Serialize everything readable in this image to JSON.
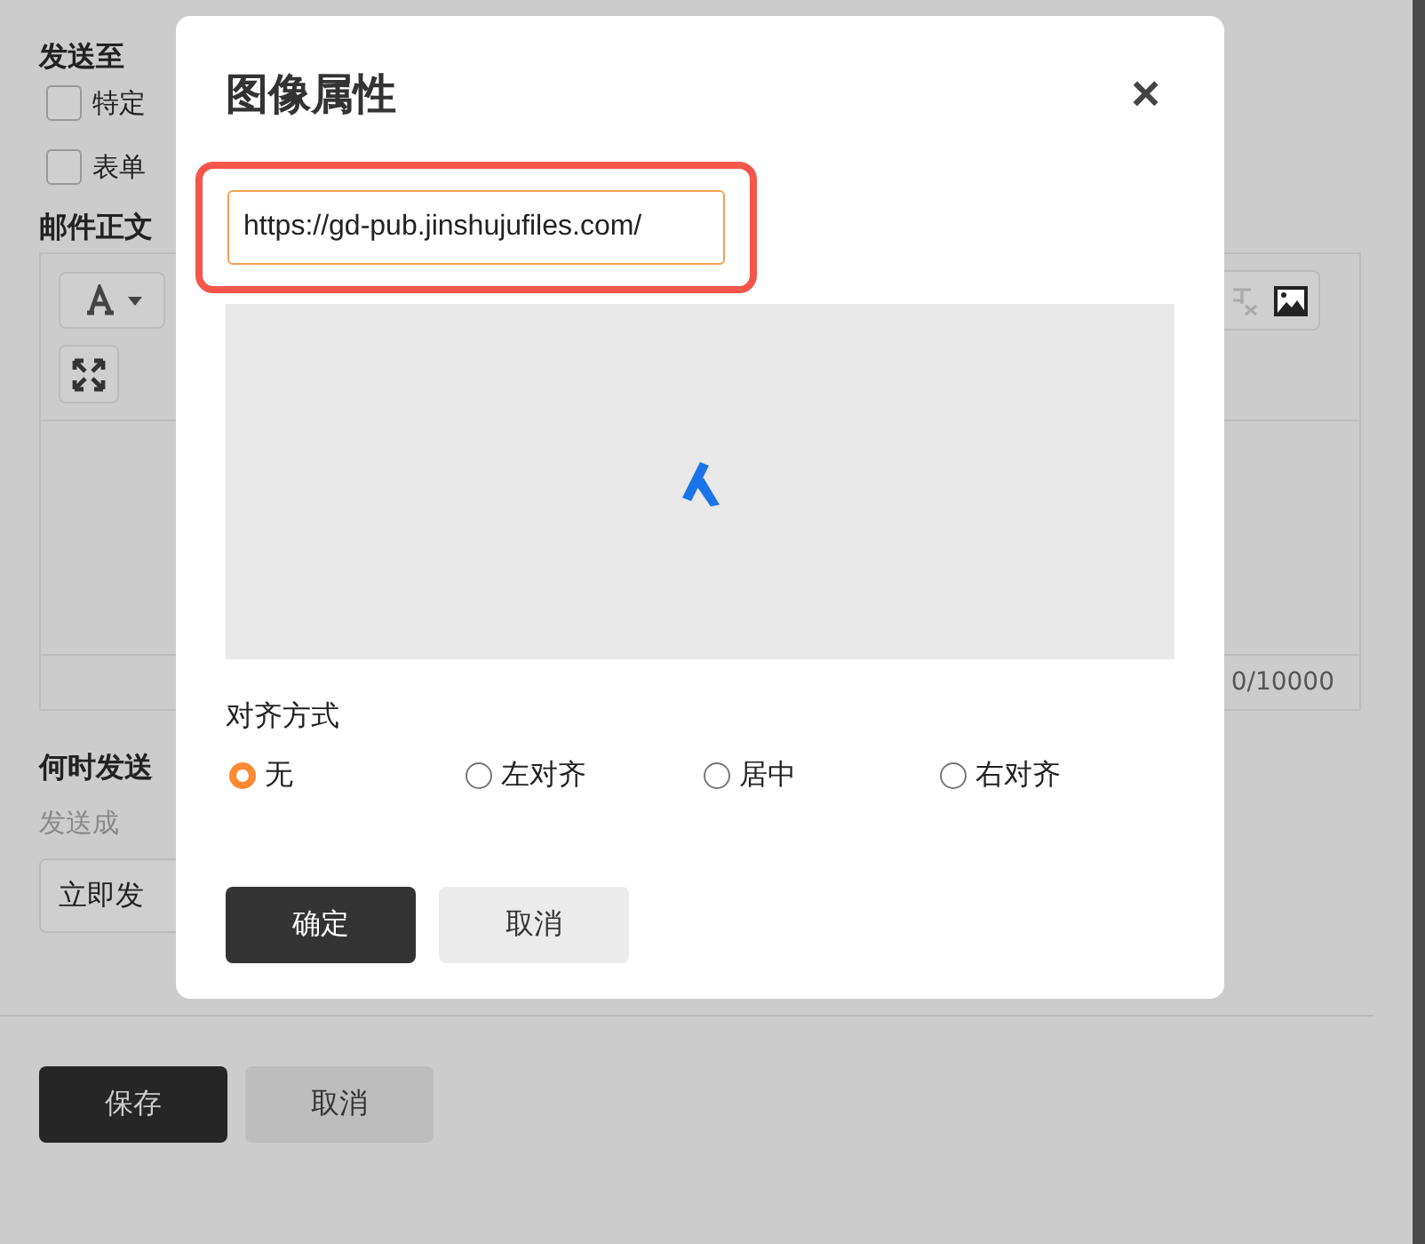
{
  "form": {
    "send_to_label": "发送至",
    "recipients": [
      {
        "label": "特定",
        "checked": false
      },
      {
        "label": "表单",
        "checked": false
      }
    ],
    "body_label": "邮件正文",
    "char_count": "0/10000",
    "when_label": "何时发送",
    "when_hint": "发送成",
    "when_button": "立即发",
    "buttons": [
      "保存",
      "取消"
    ]
  },
  "dialog": {
    "title": "图像属性",
    "close": "×",
    "url": "https://gd-pub.jinshujufiles.com/",
    "url_highlighted": true,
    "alignment_label": "对齐方式",
    "alignment": [
      {
        "label": "无",
        "selected": true
      },
      {
        "label": "左对齐",
        "selected": false
      },
      {
        "label": "居中",
        "selected": false
      },
      {
        "label": "右对齐",
        "selected": false
      }
    ],
    "buttons": [
      "确定",
      "取消"
    ]
  }
}
